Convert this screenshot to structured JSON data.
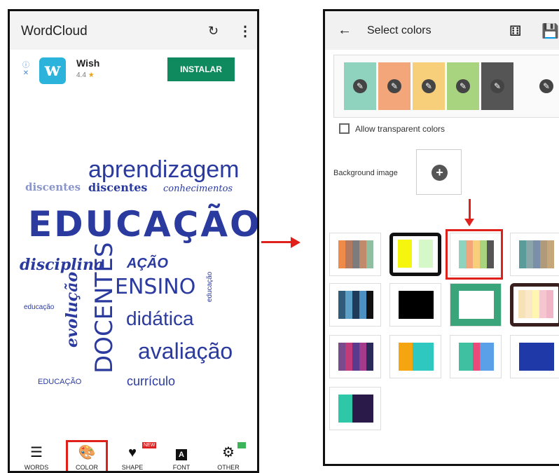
{
  "left_screen": {
    "app_title": "WordCloud",
    "ad": {
      "name": "Wish",
      "rating": "4.4",
      "install_label": "INSTALAR",
      "logo_letter": "w"
    },
    "cloud_words": [
      "aprendizagem",
      "discentes",
      "discentes",
      "conhecimentos",
      "EDUCAÇÃO",
      "disciplina",
      "AÇÃO",
      "ENSINO",
      "educação",
      "educação",
      "evolução",
      "DOCENTES",
      "didática",
      "avaliação",
      "EDUCAÇÃO",
      "currículo"
    ],
    "bottom_nav": [
      {
        "label": "WORDS",
        "icon": "list-icon"
      },
      {
        "label": "COLOR",
        "icon": "palette-icon"
      },
      {
        "label": "SHAPE",
        "icon": "heart-icon",
        "badge": "NEW"
      },
      {
        "label": "FONT",
        "icon": "font-icon"
      },
      {
        "label": "OTHER",
        "icon": "gear-icon"
      }
    ]
  },
  "right_screen": {
    "title": "Select colors",
    "selected_colors": [
      "#8fd3be",
      "#f3a67a",
      "#f7cf7a",
      "#a8d47f",
      "#555555"
    ],
    "allow_transparent_label": "Allow transparent colors",
    "background_image_label": "Background image",
    "palettes": [
      [
        "#f08a4b",
        "#b47a5f",
        "#7c7c7c",
        "#c18a6a",
        "#8fbfa0"
      ],
      [
        "#f6f50e",
        "#f6f50e",
        "#ffffff",
        "#d6f7c8",
        "#d6f7c8"
      ],
      [
        "#8fd3be",
        "#f3a67a",
        "#f7cf7a",
        "#a8d47f",
        "#555555"
      ],
      [
        "#5a9c9a",
        "#8aa6a8",
        "#7c8fa8",
        "#b19a7a",
        "#c6a77a"
      ],
      [
        "#2f5c7a",
        "#5ca0c8",
        "#1e3c5a",
        "#4a90c2",
        "#111111"
      ],
      [
        "#000000"
      ],
      [
        "#ffffff"
      ],
      [
        "#f7e2b8",
        "#fbe8c8",
        "#fff6b0",
        "#f6c6d0",
        "#f0b6c8"
      ],
      [
        "#7a4b8c",
        "#c23a7a",
        "#5a3a8c",
        "#a43a8a",
        "#2a2a5a"
      ],
      [
        "#f5a50f",
        "#f5a50f",
        "#2ec8c0",
        "#2ec8c0",
        "#2ec8c0"
      ],
      [
        "#3fc0a0",
        "#3fc0a0",
        "#e94a7a",
        "#5aa0e8",
        "#5aa0e8"
      ],
      [
        "#1f3aa8"
      ],
      [
        "#2ec8a8",
        "#2ec8a8",
        "#2a1a4a",
        "#2a1a4a",
        "#2a1a4a"
      ]
    ]
  },
  "colors": {
    "accent_red": "#e0201a",
    "word_blue": "#2a3a9e",
    "install_green": "#0f8a5f"
  }
}
